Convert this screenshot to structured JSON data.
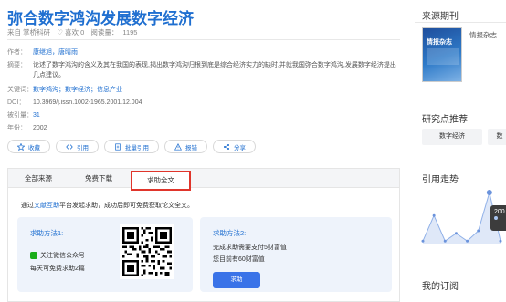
{
  "article": {
    "title": "弥合数字鸿沟发展数字经济",
    "source": "来自 掌桥科研",
    "likes": "♡ 喜欢 0",
    "reads": "阅读量：",
    "read_count": "1195"
  },
  "fields": {
    "author_label": "作者：",
    "authors": "康继旭，唐晴雨",
    "abstract_label": "摘要：",
    "abstract": "论述了数字鸿沟的含义及其在我国的表现,揭出数字鸿沟归根到底是综合经济实力的缺时,并就我国弥合数字鸿沟,发展数字经济提出几点建议。",
    "keywords_label": "关键词：",
    "keywords": "数字鸿沟；数字经济；信息产业",
    "doi_label": "DOI：",
    "doi": "10.3969/j.issn.1002-1965.2001.12.004",
    "cited_label": "被引量：",
    "cited": "31",
    "year_label": "年份：",
    "year": "2002"
  },
  "actions": {
    "favorite": "收藏",
    "cite": "引用",
    "batch_cite": "批量引用",
    "report": "报错",
    "share": "分享"
  },
  "tabs": {
    "all_sources": "全部来源",
    "free_download": "免费下载",
    "help_fulltext": "求助全文"
  },
  "notice": {
    "prefix": "通过",
    "link": "文献互助",
    "suffix": "平台发起求助，成功后即可免费获取论文全文。"
  },
  "help_method_1": {
    "title": "求助方法1:",
    "line1": "关注微信公众号",
    "line2": "每天可免费求助2篇"
  },
  "help_method_2": {
    "title": "求助方法2:",
    "line1": "完成求助需要支付5财富值",
    "line2": "您目前有60财富值",
    "button": "求助"
  },
  "sidebar": {
    "source_journal_title": "来源期刊",
    "journal_name": "情报杂志",
    "cover_text": "情报杂志",
    "hot_topics_title": "研究点推荐",
    "topics": [
      "数字经济",
      "数"
    ],
    "trend_title": "引用走势",
    "tooltip_value": "200",
    "my_subscription_title": "我的订阅"
  },
  "colors": {
    "accent": "#1f6fd0",
    "active_tab_border": "#e0352b",
    "button": "#3a73e8",
    "card_bg": "#eef3fb",
    "wechat": "#1aad19"
  },
  "chart_data": {
    "type": "area",
    "title": "",
    "xlabel": "",
    "ylabel": "",
    "series": [
      {
        "values": [
          0.05,
          0.55,
          0.05,
          0.2,
          0.05,
          0.25,
          1.0,
          0.05
        ]
      }
    ]
  }
}
